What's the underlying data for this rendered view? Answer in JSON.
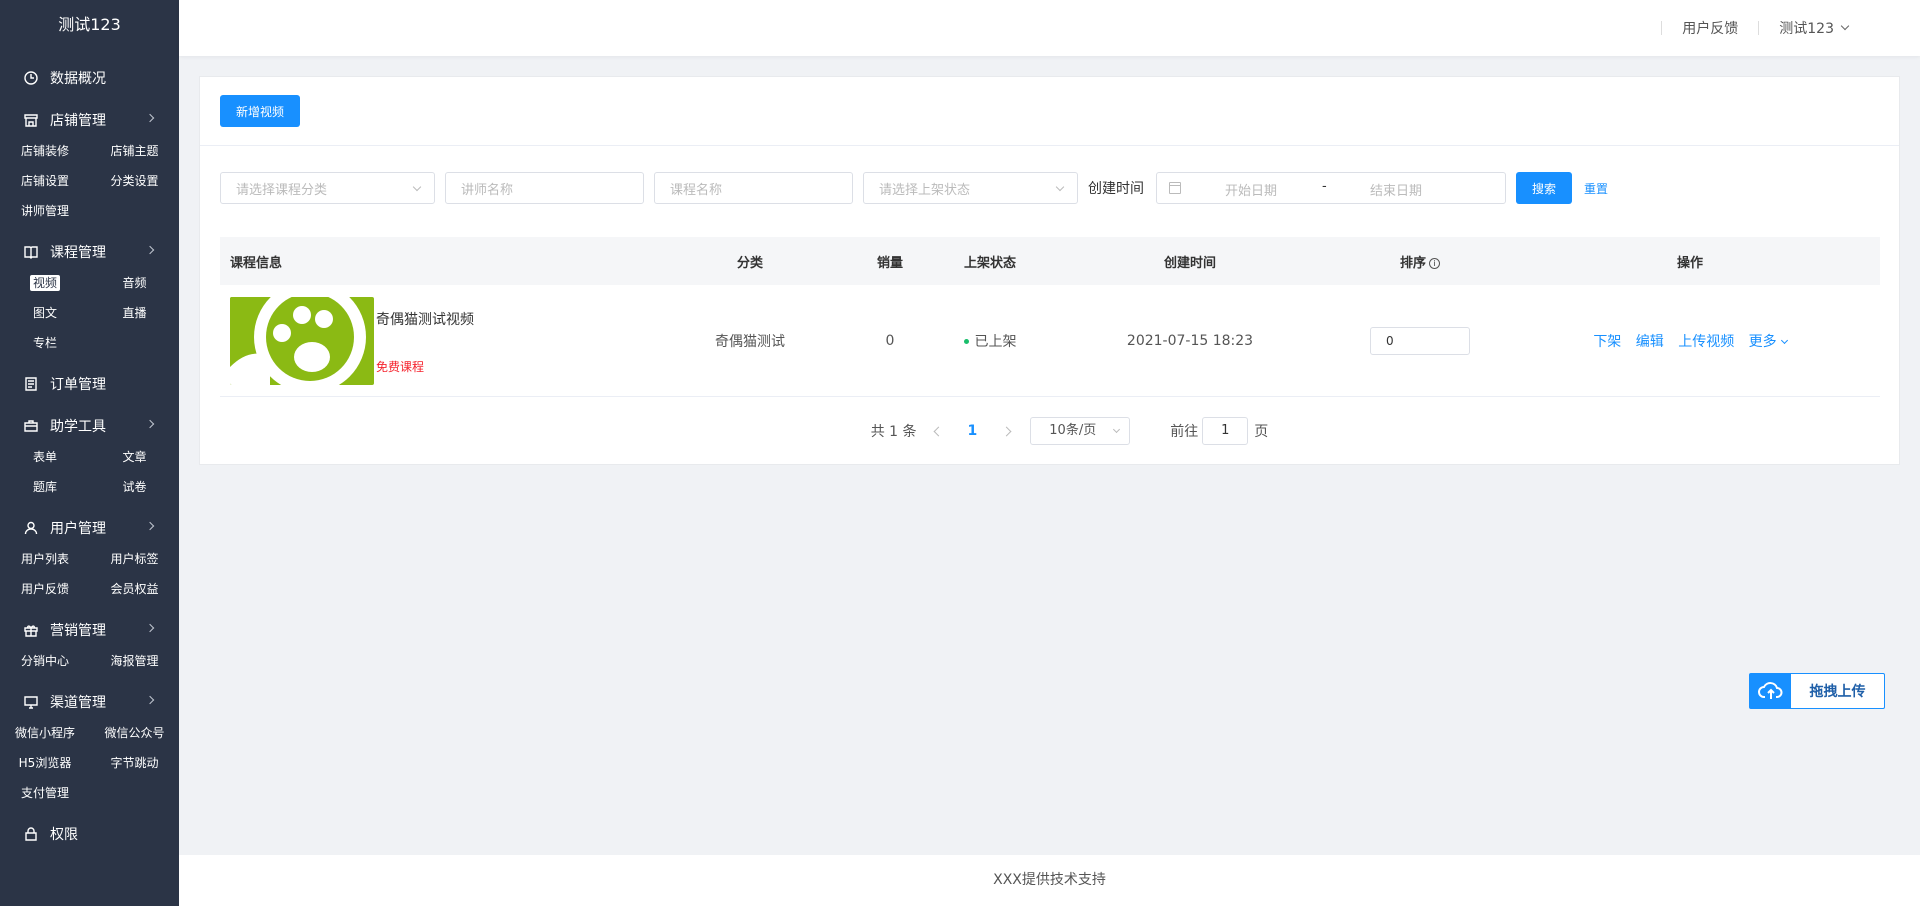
{
  "app": {
    "logo": "测试123"
  },
  "sidebar": {
    "groups": [
      {
        "label": "数据概况",
        "icon": "clock-icon",
        "items": []
      },
      {
        "label": "店铺管理",
        "icon": "store-icon",
        "items": [
          "店铺装修",
          "店铺主题",
          "店铺设置",
          "分类设置",
          "讲师管理"
        ]
      },
      {
        "label": "课程管理",
        "icon": "book-icon",
        "items": [
          "视频",
          "音频",
          "图文",
          "直播",
          "专栏"
        ]
      },
      {
        "label": "订单管理",
        "icon": "document-icon",
        "items": []
      },
      {
        "label": "助学工具",
        "icon": "briefcase-icon",
        "items": [
          "表单",
          "文章",
          "题库",
          "试卷"
        ]
      },
      {
        "label": "用户管理",
        "icon": "user-icon",
        "items": [
          "用户列表",
          "用户标签",
          "用户反馈",
          "会员权益"
        ]
      },
      {
        "label": "营销管理",
        "icon": "gift-icon",
        "items": [
          "分销中心",
          "海报管理"
        ]
      },
      {
        "label": "渠道管理",
        "icon": "monitor-icon",
        "items": [
          "微信小程序",
          "微信公众号",
          "H5浏览器",
          "字节跳动",
          "支付管理"
        ]
      },
      {
        "label": "权限",
        "icon": "lock-icon",
        "items": []
      }
    ],
    "active_item": "视频"
  },
  "header": {
    "feedback": "用户反馈",
    "user": "测试123"
  },
  "toolbar": {
    "add_label": "新增视频"
  },
  "filters": {
    "category_placeholder": "请选择课程分类",
    "teacher_placeholder": "讲师名称",
    "course_placeholder": "课程名称",
    "status_placeholder": "请选择上架状态",
    "created_label": "创建时间",
    "start_placeholder": "开始日期",
    "range_sep": "-",
    "end_placeholder": "结束日期",
    "search_label": "搜索",
    "reset_label": "重置"
  },
  "table": {
    "columns": [
      "课程信息",
      "分类",
      "销量",
      "上架状态",
      "创建时间",
      "排序",
      "操作"
    ],
    "sort_info": "i",
    "rows": [
      {
        "title": "奇偶猫测试视频",
        "tag": "免费课程",
        "category": "奇偶猫测试",
        "sales": "0",
        "status": "已上架",
        "created": "2021-07-15 18:23",
        "sort": "0",
        "ops": [
          "下架",
          "编辑",
          "上传视频",
          "更多"
        ]
      }
    ]
  },
  "pagination": {
    "total": "共 1 条",
    "current": "1",
    "page_size": "10条/页",
    "goto_prefix": "前往",
    "goto_value": "1",
    "goto_suffix": "页"
  },
  "upload": {
    "label": "拖拽上传"
  },
  "footer": {
    "text": "XXX提供技术支持"
  },
  "colors": {
    "sidebar": "#2b3446",
    "primary": "#1890ff",
    "success": "#19be6b",
    "danger": "#f5222d"
  }
}
